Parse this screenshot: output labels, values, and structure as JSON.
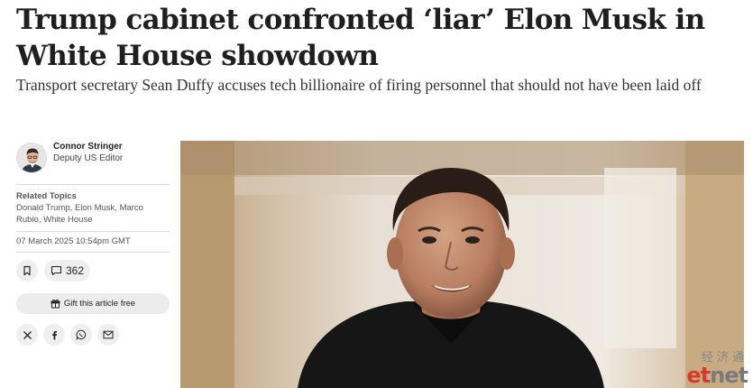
{
  "article": {
    "headline": "Trump cabinet confronted ‘liar’ Elon Musk in White House showdown",
    "standfirst": "Transport secretary Sean Duffy accuses tech billionaire of firing personnel that should not have been laid off"
  },
  "author": {
    "name": "Connor Stringer",
    "role": "Deputy US Editor"
  },
  "related": {
    "label": "Related Topics",
    "topics": "Donald Trump, Elon Musk, Marco Rubio, White House"
  },
  "date": "07 March 2025 10:54pm GMT",
  "actions": {
    "bookmark_icon": "bookmark-icon",
    "comment_icon": "comment-icon",
    "comment_count": "362",
    "gift_icon": "gift-icon",
    "gift_label": "Gift this article free"
  },
  "share": [
    "x-icon",
    "facebook-icon",
    "whatsapp-icon",
    "email-icon"
  ],
  "watermark": {
    "chinese": "经济通",
    "logo_et": "et",
    "logo_net": "net"
  },
  "colors": {
    "headline": "#1f1f1f",
    "pill_bg": "#efefef",
    "logo_red": "#d63a2a",
    "logo_grey": "#7a7a7a"
  }
}
